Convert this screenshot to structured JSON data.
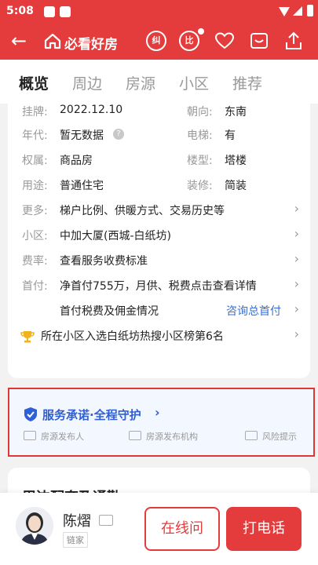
{
  "status_bar": {
    "time": "5:08"
  },
  "header": {
    "brand": "必看好房",
    "icon_jiu": "纠",
    "icon_bi": "比"
  },
  "tabs": [
    {
      "label": "概览"
    },
    {
      "label": "周边"
    },
    {
      "label": "房源"
    },
    {
      "label": "小区"
    },
    {
      "label": "推荐"
    }
  ],
  "details": {
    "listing_label": "挂牌:",
    "listing_value": "2022.12.10",
    "orientation_label": "朝向:",
    "orientation_value": "东南",
    "year_label": "年代:",
    "year_value": "暂无数据",
    "elevator_label": "电梯:",
    "elevator_value": "有",
    "ownership_label": "权属:",
    "ownership_value": "商品房",
    "building_label": "楼型:",
    "building_value": "塔楼",
    "usage_label": "用途:",
    "usage_value": "普通住宅",
    "decoration_label": "装修:",
    "decoration_value": "简装",
    "more_label": "更多:",
    "more_value": "梯户比例、供暖方式、交易历史等",
    "community_label": "小区:",
    "community_value": "中加大厦(西城-白纸坊)",
    "fees_label": "费率:",
    "fees_value": "查看服务收费标准",
    "down_label": "首付:",
    "down_value": "净首付755万，月供、税费点击查看详情",
    "down_sub": "首付税费及佣金情况",
    "down_link": "咨询总首付",
    "ranking": "所在小区入选白纸坊热搜小区榜第6名"
  },
  "promise": {
    "title": "服务承诺·全程守护",
    "item1": "房源发布人",
    "item2": "房源发布机构",
    "item3": "风险提示"
  },
  "next_section": {
    "title": "周边配套及通勤"
  },
  "agent": {
    "name": "陈熠",
    "company": "链家",
    "chat_label": "在线问",
    "call_label": "打电话"
  },
  "colors": {
    "brand_red": "#e43c3c",
    "link_blue": "#3a6fd0",
    "promise_blue": "#2f5fd6"
  }
}
